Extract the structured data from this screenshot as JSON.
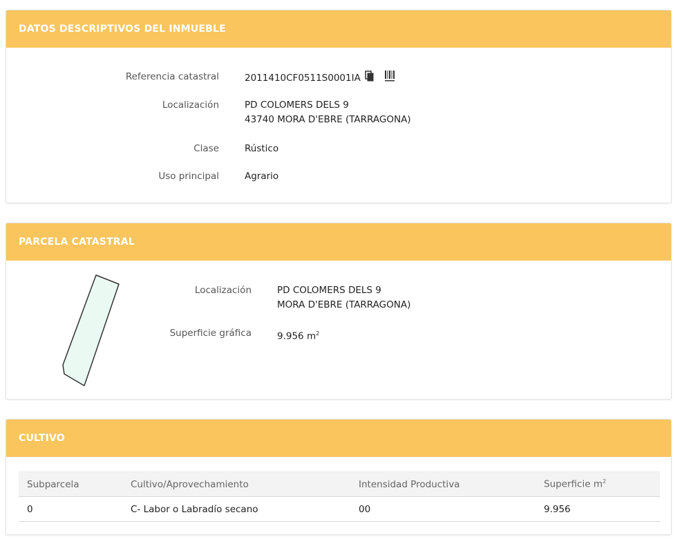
{
  "datos": {
    "title": "DATOS DESCRIPTIVOS DEL INMUEBLE",
    "ref_label": "Referencia catastral",
    "ref_value": "2011410CF0511S0001IA",
    "loc_label": "Localización",
    "loc_line1": "PD COLOMERS DELS 9",
    "loc_line2": "43740 MORA D'EBRE (TARRAGONA)",
    "clase_label": "Clase",
    "clase_value": "Rústico",
    "uso_label": "Uso principal",
    "uso_value": "Agrario",
    "icons": [
      "copy-icon",
      "barcode-icon"
    ]
  },
  "parcela": {
    "title": "PARCELA CATASTRAL",
    "loc_label": "Localización",
    "loc_line1": "PD COLOMERS DELS 9",
    "loc_line2": "MORA D'EBRE (TARRAGONA)",
    "sup_label": "Superficie gráfica",
    "sup_value": "9.956 m",
    "sup_unit_sup": "2",
    "shape_fill": "#eafaf3"
  },
  "cultivo": {
    "title": "CULTIVO",
    "headers": {
      "subparcela": "Subparcela",
      "cultivo": "Cultivo/Aprovechamiento",
      "intensidad": "Intensidad Productiva",
      "superficie": "Superficie m",
      "superficie_sup": "2"
    },
    "rows": [
      {
        "subparcela": "0",
        "cultivo": "C- Labor o Labradío secano",
        "intensidad": "00",
        "superficie": "9.956"
      }
    ]
  },
  "colors": {
    "header_bg": "#f9c55c",
    "header_text": "#ffffff"
  }
}
